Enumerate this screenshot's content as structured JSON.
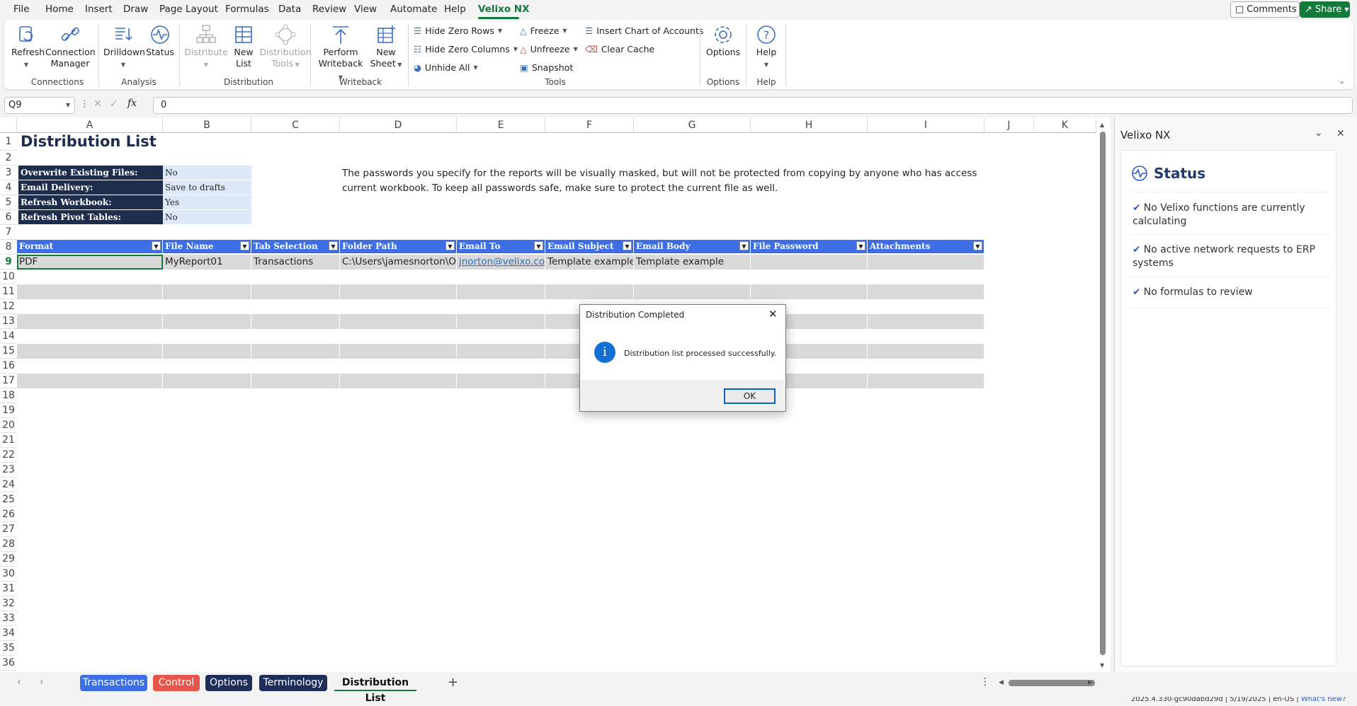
{
  "menu": {
    "tabs": [
      "File",
      "Home",
      "Insert",
      "Draw",
      "Page Layout",
      "Formulas",
      "Data",
      "Review",
      "View",
      "Automate",
      "Help",
      "Velixo NX"
    ],
    "active_tab": "Velixo NX",
    "comments_label": "Comments",
    "share_label": "Share"
  },
  "ribbon": {
    "refresh": "Refresh",
    "connection_manager": [
      "Connection",
      "Manager"
    ],
    "drilldown": "Drilldown",
    "status": "Status",
    "distribute": "Distribute",
    "new_list": [
      "New",
      "List"
    ],
    "distribution_tools": [
      "Distribution",
      "Tools"
    ],
    "perform_writeback": [
      "Perform",
      "Writeback"
    ],
    "new_sheet": [
      "New",
      "Sheet"
    ],
    "hide_zero_rows": "Hide Zero Rows",
    "hide_zero_columns": "Hide Zero Columns",
    "unhide_all": "Unhide All",
    "freeze": "Freeze",
    "unfreeze": "Unfreeze",
    "snapshot": "Snapshot",
    "insert_chart_of_accounts": "Insert Chart of Accounts",
    "clear_cache": "Clear Cache",
    "options": "Options",
    "help": "Help",
    "groups": {
      "connections": "Connections",
      "analysis": "Analysis",
      "distribution": "Distribution",
      "writeback": "Writeback",
      "tools": "Tools",
      "options": "Options",
      "help": "Help"
    }
  },
  "formula_bar": {
    "name_box": "Q9",
    "formula": "0",
    "fx": "fx"
  },
  "sheet": {
    "columns": [
      "A",
      "B",
      "C",
      "D",
      "E",
      "F",
      "G",
      "H",
      "I",
      "J",
      "K"
    ],
    "rows": [
      "1",
      "2",
      "3",
      "4",
      "5",
      "6",
      "7",
      "8",
      "9",
      "10",
      "11",
      "12",
      "13",
      "14",
      "15",
      "16",
      "17",
      "18",
      "19",
      "20",
      "21",
      "22",
      "23",
      "24",
      "25",
      "26",
      "27",
      "28",
      "29",
      "30",
      "31",
      "32",
      "33",
      "34",
      "35",
      "36"
    ],
    "title": "Distribution List",
    "settings": [
      {
        "label": "Overwrite Existing Files:",
        "value": "No"
      },
      {
        "label": "Email Delivery:",
        "value": "Save to drafts"
      },
      {
        "label": "Refresh Workbook:",
        "value": "Yes"
      },
      {
        "label": "Refresh Pivot Tables:",
        "value": "No"
      }
    ],
    "note_line1": "The passwords you specify for the reports will be visually masked, but will not be protected from copying by anyone who has access to the",
    "note_line2": "current workbook. To keep all passwords safe, make sure to protect the current file as well.",
    "table_headers": [
      "Format",
      "File Name",
      "Tab Selection",
      "Folder Path",
      "Email To",
      "Email Subject",
      "Email Body",
      "File Password",
      "Attachments"
    ],
    "row9": [
      "PDF",
      "MyReport01",
      "Transactions",
      "C:\\Users\\jamesnorton\\O",
      "jnorton@velixo.com",
      "Template example",
      "Template example",
      "",
      ""
    ]
  },
  "panel": {
    "title": "Velixo NX",
    "section": "Status",
    "items": [
      "No Velixo functions are currently calculating",
      "No active network requests to ERP systems",
      "No formulas to review"
    ],
    "version": "2025.4.330-gc90dabd29d | 5/19/2025 | en-US |",
    "whats_new": "What's new?"
  },
  "sheet_tabs": [
    {
      "name": "Transactions",
      "color": "#3c6ee6"
    },
    {
      "name": "Control",
      "color": "#e8554a"
    },
    {
      "name": "Options",
      "color": "#1f2d5a"
    },
    {
      "name": "Terminology",
      "color": "#1f2d5a"
    },
    {
      "name": "Distribution List",
      "color": ""
    }
  ],
  "dialog": {
    "title": "Distribution Completed",
    "message": "Distribution list processed successfully.",
    "ok": "OK"
  }
}
